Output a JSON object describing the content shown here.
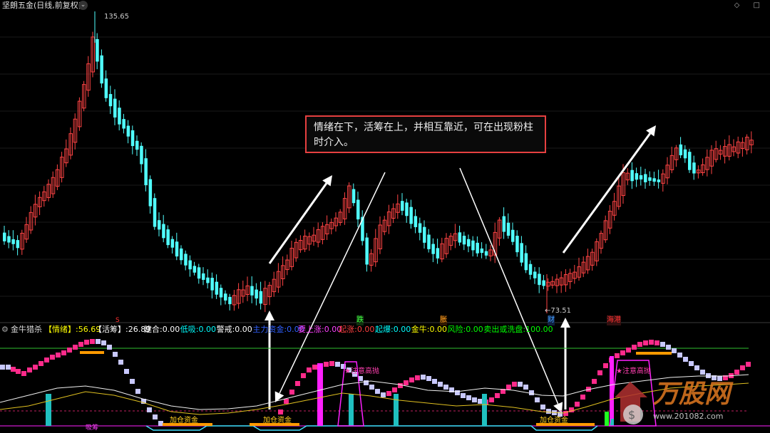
{
  "header": {
    "title": "坚朗五金(日线,前复权)",
    "nav_icons": "◇ □"
  },
  "price_chart": {
    "high_label": "135.65",
    "low_label": "←73.51",
    "markers": {
      "s": "S",
      "die": "跌",
      "zhang": "胀",
      "cai": "财",
      "haigang": "海港"
    }
  },
  "annotation": {
    "text": "情绪在下，活筹在上，并相互靠近，可在出现粉柱时介入。"
  },
  "indicator": {
    "name": "金牛猎杀",
    "items": [
      {
        "label": "【情绪】:",
        "value": "56.69",
        "color": "#ffff00"
      },
      {
        "label": "【活筹】:",
        "value": "26.89",
        "color": "#ffffff"
      },
      {
        "label": "建合:",
        "value": "0.00",
        "color": "#ffffff"
      },
      {
        "label": "低吸:",
        "value": "0.00",
        "color": "#00ffff"
      },
      {
        "label": "警戒:",
        "value": "0.00",
        "color": "#ffffff"
      },
      {
        "label": "主力资金:",
        "value": "0.00",
        "color": "#3060ff"
      },
      {
        "label": "要上涨:",
        "value": "0.00",
        "color": "#ff40ff"
      },
      {
        "label": "起涨:",
        "value": "0.00",
        "color": "#ff4040"
      },
      {
        "label": "起爆:",
        "value": "0.00",
        "color": "#00ffff"
      },
      {
        "label": "金牛:",
        "value": "0.00",
        "color": "#ffff00"
      },
      {
        "label": "风险:",
        "value": "0.00",
        "color": "#00ff00"
      },
      {
        "label": "卖出或洗盘:",
        "value": "100.00",
        "color": "#00ff00"
      }
    ],
    "labels": {
      "jiacang1": "加仓资金",
      "jiacang2": "加仓资金",
      "jiacang3": "加仓资金",
      "zhuyi1": "★注意高抛",
      "zhuyi2": "★注意高抛",
      "bottom_left": "吸筹"
    }
  },
  "watermark": {
    "brand": "万股网",
    "url": "www.201082.com"
  },
  "colors": {
    "up": "#ff4444",
    "down": "#50ffff",
    "pink": "#ff2a8a",
    "lavender": "#c8c8ff",
    "magenta": "#ff20ff",
    "teal": "#20c0c0"
  }
}
